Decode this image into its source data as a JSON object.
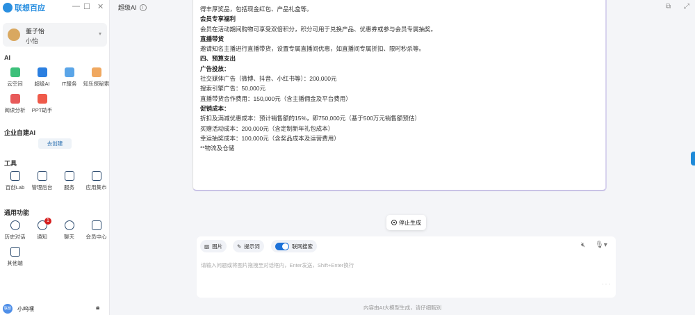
{
  "app": {
    "name": "联想百应",
    "title": "超级AI"
  },
  "user": {
    "name": "董子怡",
    "role": "小怡",
    "bottom_name": "小呜嘿",
    "avatar_text": "联想"
  },
  "sections": {
    "ai": {
      "label": "AI",
      "items": [
        {
          "label": "云空间",
          "color": "#3cc07a"
        },
        {
          "label": "超级AI",
          "color": "#2b7fe0"
        },
        {
          "label": "IT服务",
          "color": "#5aa5e8"
        },
        {
          "label": "知乐探秘索",
          "color": "#f0a860"
        },
        {
          "label": "阅读分析",
          "color": "#e85a5a"
        },
        {
          "label": "PPT助手",
          "color": "#ef5a4a"
        }
      ]
    },
    "enterprise": {
      "label": "企业自建AI",
      "button": "去创建"
    },
    "tools": {
      "label": "工具",
      "items": [
        {
          "label": "百创Lab"
        },
        {
          "label": "管理后台"
        },
        {
          "label": "服务"
        },
        {
          "label": "应用集市"
        }
      ]
    },
    "common": {
      "label": "通用功能",
      "items": [
        {
          "label": "历史对话"
        },
        {
          "label": "通知",
          "badge": "1"
        },
        {
          "label": "聊天"
        },
        {
          "label": "会员中心"
        },
        {
          "label": "其他端"
        }
      ]
    }
  },
  "content": {
    "lines": [
      {
        "text": "得丰厚奖品，包括现金红包、产品礼盒等。",
        "bold": false
      },
      {
        "text": "会员专享福利",
        "bold": true
      },
      {
        "text": "会员在活动期间购物可享受双倍积分，积分可用于兑换产品、优惠券或参与会员专属抽奖。",
        "bold": false
      },
      {
        "text": "直播带货",
        "bold": true
      },
      {
        "text": "邀请知名主播进行直播带货，设置专属直播间优惠，如直播间专属折扣、限时秒杀等。",
        "bold": false
      },
      {
        "text": "四、预算支出",
        "bold": true
      },
      {
        "text": "广告投放：",
        "bold": true
      },
      {
        "text": "社交媒体广告（微博、抖音、小红书等）：200,000元",
        "bold": false
      },
      {
        "text": "搜索引擎广告：50,000元",
        "bold": false
      },
      {
        "text": "直播带货合作费用：150,000元（含主播佣金及平台费用）",
        "bold": false
      },
      {
        "text": "促销成本：",
        "bold": true
      },
      {
        "text": "折扣及满减优惠成本：预计销售额的15%，即750,000元（基于500万元销售额预估）",
        "bold": false
      },
      {
        "text": "买赠活动成本：200,000元（含定制新年礼包成本）",
        "bold": false
      },
      {
        "text": "幸运抽奖成本：100,000元（含奖品成本及运营费用）",
        "bold": false
      },
      {
        "text": "**物流及仓储",
        "bold": false
      }
    ]
  },
  "stop_label": "停止生成",
  "input": {
    "image_chip": "图片",
    "prompt_chip": "提示词",
    "web_search": "联网搜索",
    "web_search_on": true,
    "placeholder": "请输入问题或将图片拖拽至对话框内，Enter发送，Shift+Enter换行"
  },
  "footer": "内容由AI大模型生成，请仔细甄别"
}
